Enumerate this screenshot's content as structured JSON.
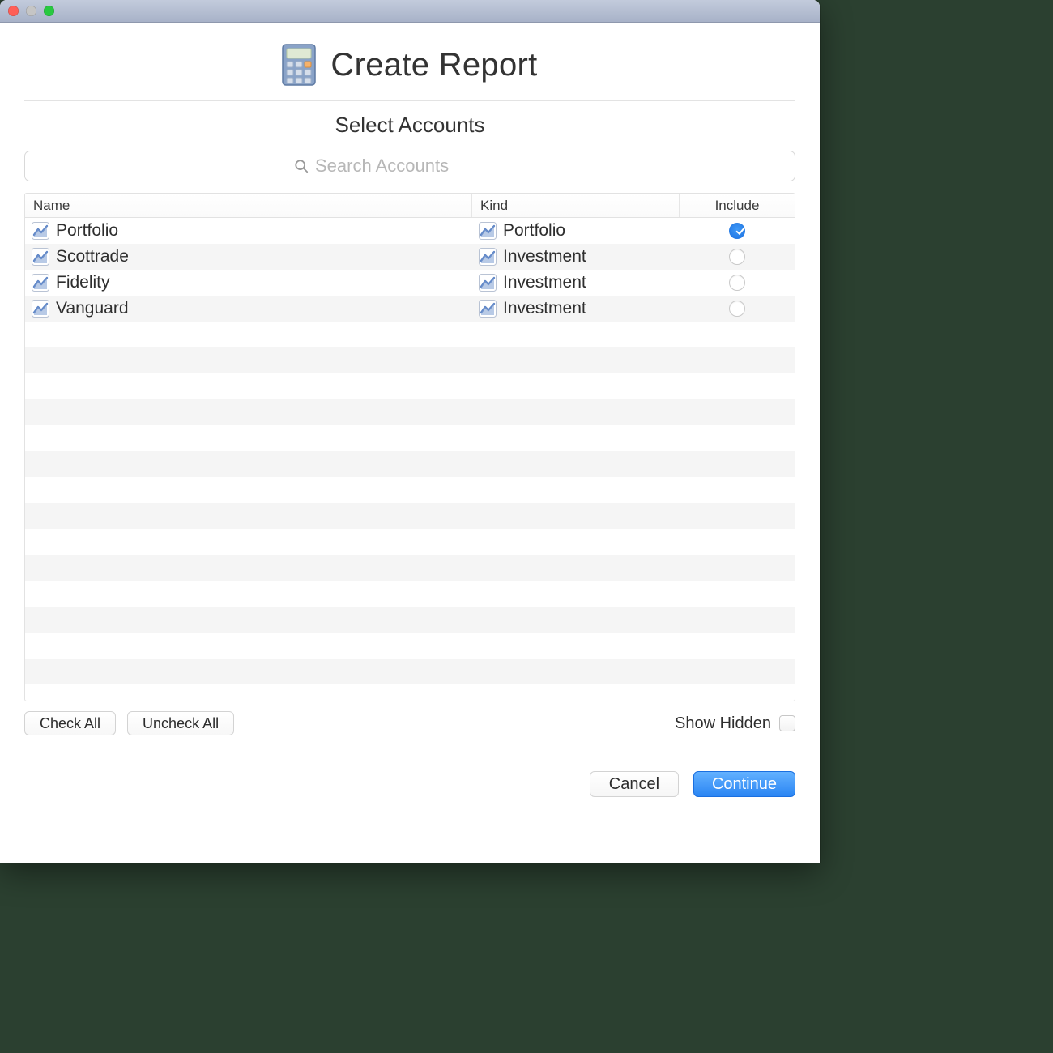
{
  "window": {
    "title": "Create Report",
    "subtitle": "Select Accounts"
  },
  "search": {
    "placeholder": "Search Accounts",
    "value": ""
  },
  "columns": {
    "name": "Name",
    "kind": "Kind",
    "include": "Include"
  },
  "rows": [
    {
      "name": "Portfolio",
      "kind": "Portfolio",
      "included": true
    },
    {
      "name": "Scottrade",
      "kind": "Investment",
      "included": false
    },
    {
      "name": "Fidelity",
      "kind": "Investment",
      "included": false
    },
    {
      "name": "Vanguard",
      "kind": "Investment",
      "included": false
    }
  ],
  "emptyRows": 14,
  "buttons": {
    "checkAll": "Check All",
    "uncheckAll": "Uncheck All",
    "showHidden": "Show Hidden",
    "cancel": "Cancel",
    "continue": "Continue"
  },
  "showHiddenChecked": false
}
